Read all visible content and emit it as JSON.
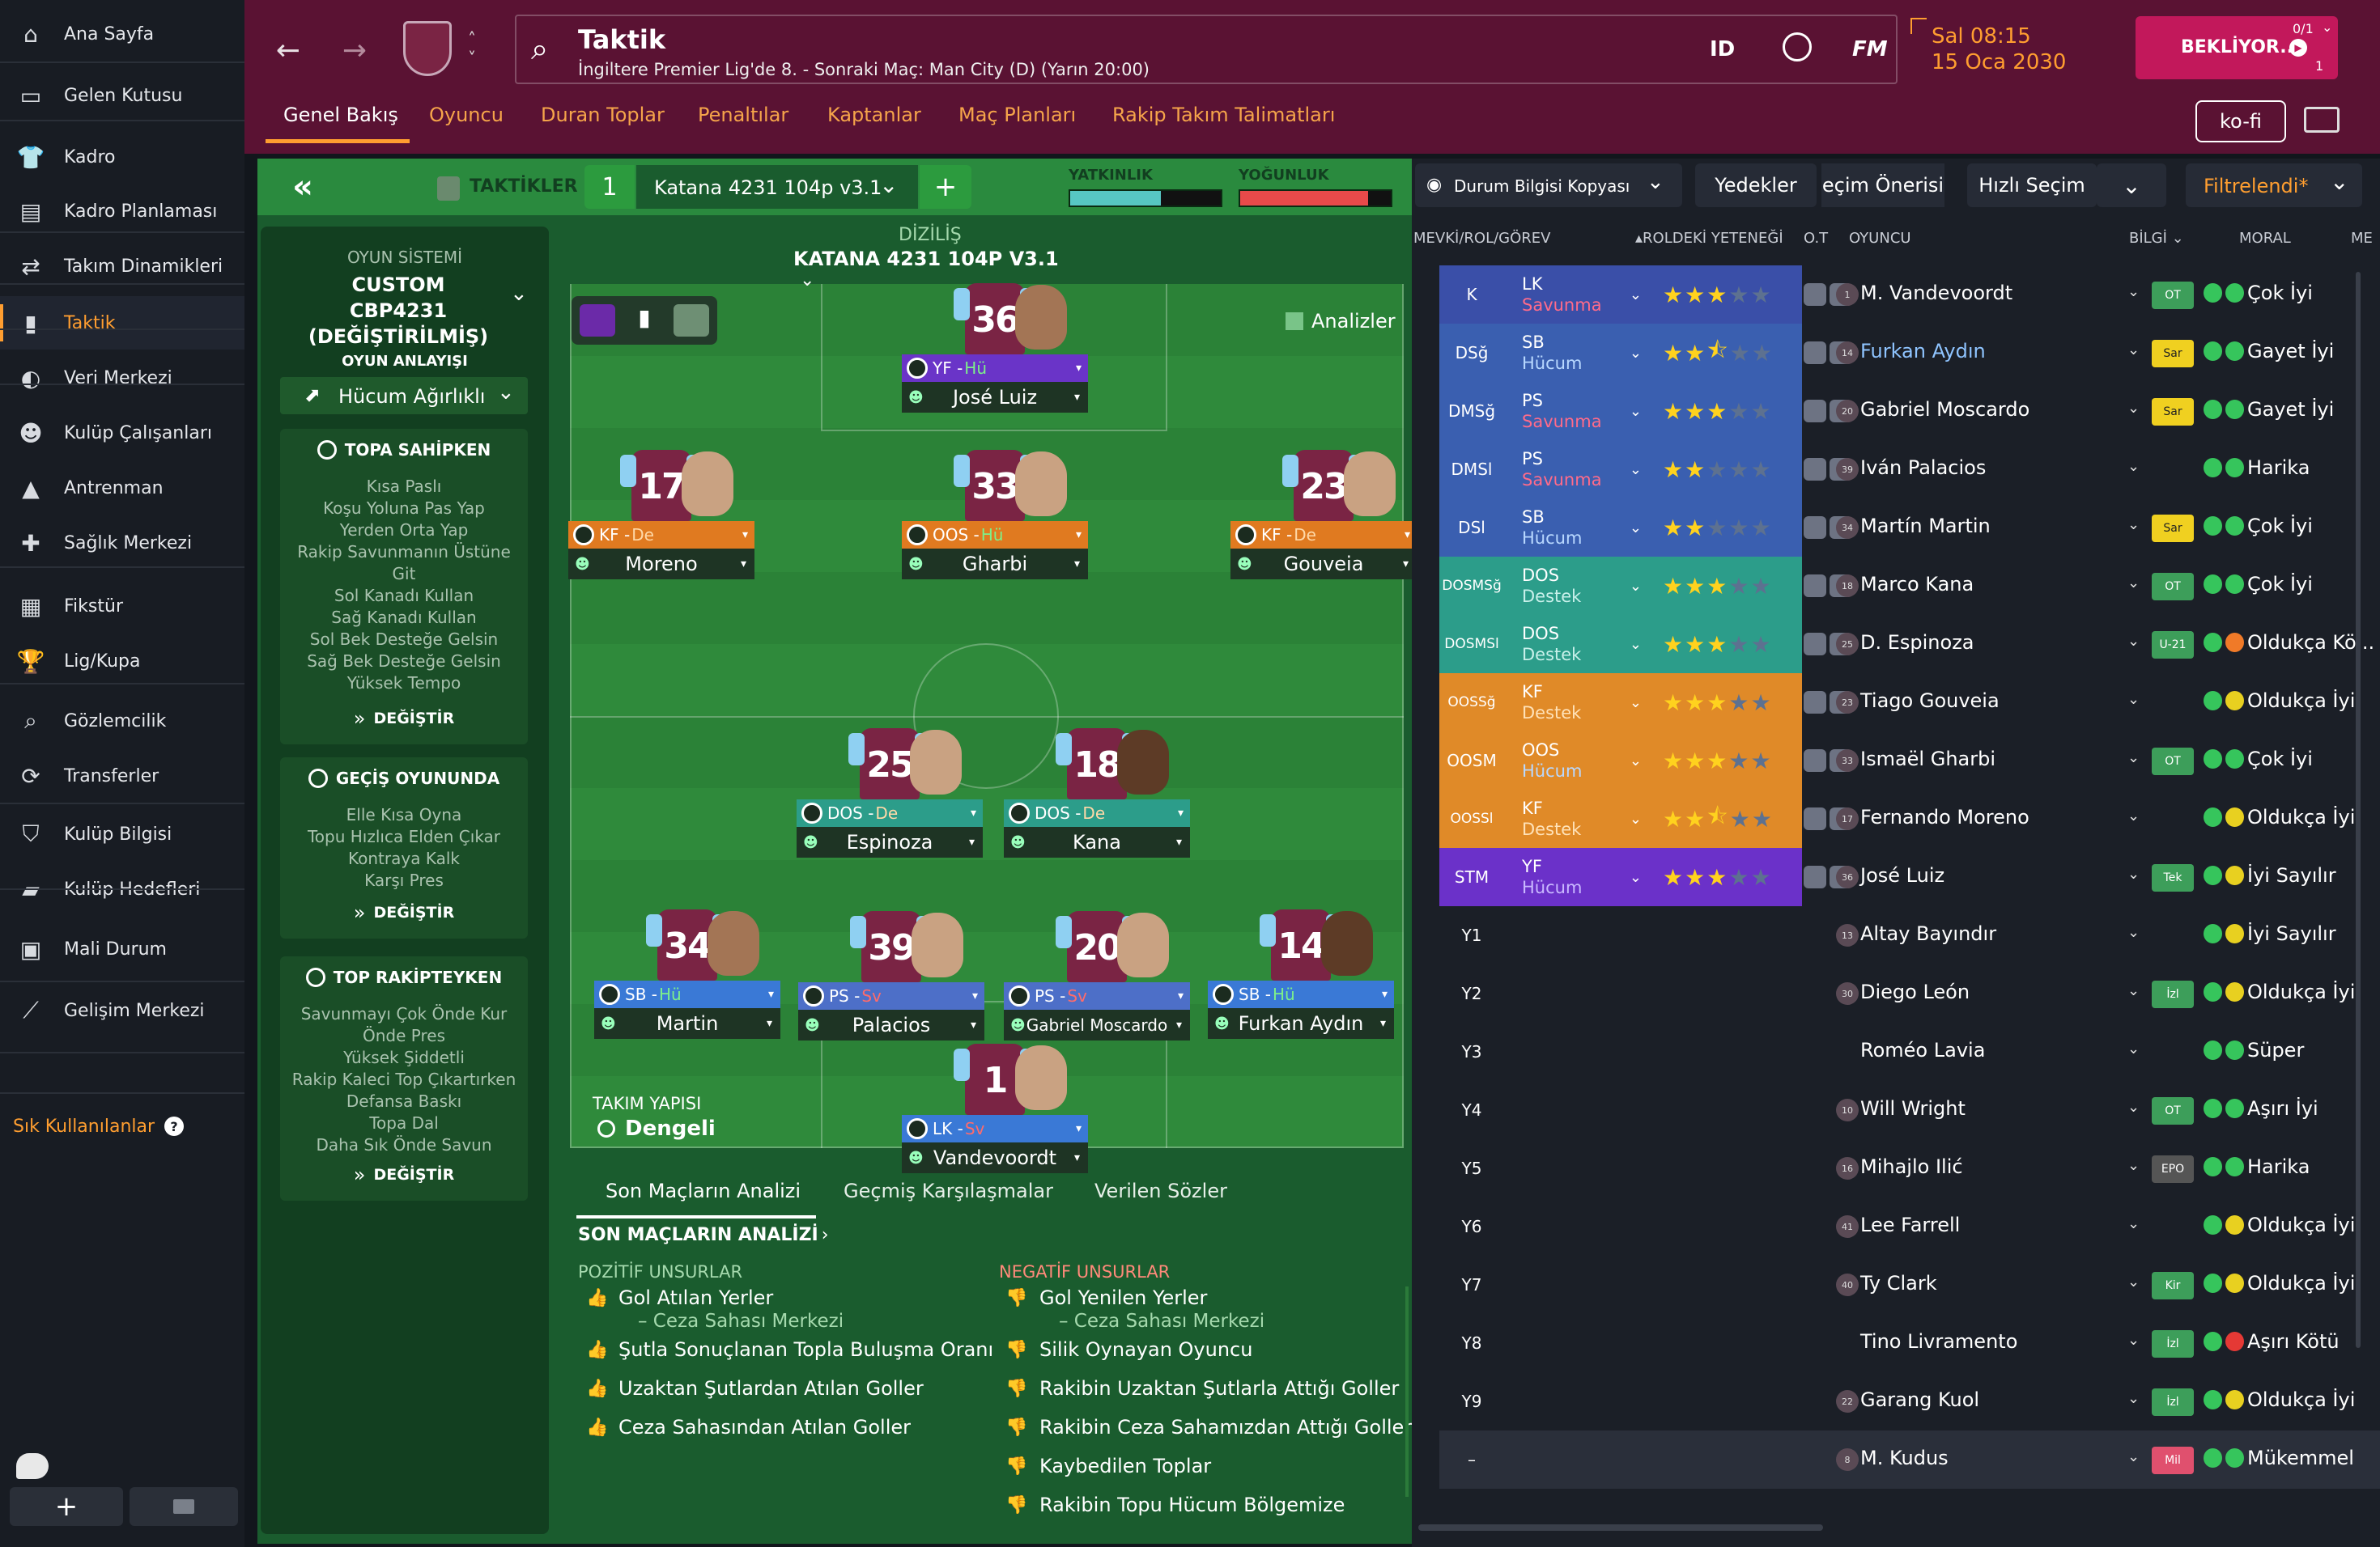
{
  "nav": {
    "items": [
      {
        "label": "Ana Sayfa",
        "icon": "home-icon",
        "glyph": "⌂"
      },
      {
        "label": "Gelen Kutusu",
        "icon": "inbox-icon",
        "glyph": "▭"
      },
      {
        "label": "Kadro",
        "icon": "shirt-icon",
        "glyph": "👕"
      },
      {
        "label": "Kadro Planlaması",
        "icon": "clipboard-icon",
        "glyph": "▤"
      },
      {
        "label": "Takım Dinamikleri",
        "icon": "dynamics-icon",
        "glyph": "⇄"
      },
      {
        "label": "Taktik",
        "icon": "tactics-icon",
        "glyph": "▮"
      },
      {
        "label": "Veri Merkezi",
        "icon": "data-icon",
        "glyph": "◐"
      },
      {
        "label": "Kulüp Çalışanları",
        "icon": "staff-icon",
        "glyph": "☻"
      },
      {
        "label": "Antrenman",
        "icon": "training-icon",
        "glyph": "▲"
      },
      {
        "label": "Sağlık Merkezi",
        "icon": "medical-icon",
        "glyph": "✚"
      },
      {
        "label": "Fikstür",
        "icon": "calendar-icon",
        "glyph": "▦"
      },
      {
        "label": "Lig/Kupa",
        "icon": "trophy-icon",
        "glyph": "🏆"
      },
      {
        "label": "Gözlemcilik",
        "icon": "scouting-icon",
        "glyph": "⌕"
      },
      {
        "label": "Transferler",
        "icon": "transfer-icon",
        "glyph": "⟳"
      },
      {
        "label": "Kulüp Bilgisi",
        "icon": "shield-icon",
        "glyph": "⛉"
      },
      {
        "label": "Kulüp Hedefleri",
        "icon": "briefcase-icon",
        "glyph": "▰"
      },
      {
        "label": "Mali Durum",
        "icon": "money-icon",
        "glyph": "▣"
      },
      {
        "label": "Gelişim Merkezi",
        "icon": "development-icon",
        "glyph": "⟋"
      }
    ],
    "favorites": "Sık Kullanılanlar",
    "help": "?"
  },
  "header": {
    "title": "Taktik",
    "subtitle": "İngiltere Premier Lig'de 8. - Sonraki Maç: Man City (D) (Yarın 20:00)",
    "id": "ID",
    "fm": "FM",
    "time": "Sal 08:15",
    "date": "15 Oca 2030",
    "waiting": "BEKLİYOR...",
    "count": "0/1",
    "users": "1",
    "kofi": "ko-fi",
    "tabs": [
      "Genel Bakış",
      "Oyuncu",
      "Duran Toplar",
      "Penaltılar",
      "Kaptanlar",
      "Maç Planları",
      "Rakip Takım Talimatları"
    ]
  },
  "tactics": {
    "collapse": "«",
    "label": "TAKTİKLER",
    "slot": "1",
    "name": "Katana 4231 104p v3.1",
    "add": "+",
    "familiarity": "YATKINLIK",
    "intensity": "YOĞUNLUK",
    "familiarity_level": 0.6,
    "intensity_level": 0.85,
    "formation_label": "DİZİLİŞ",
    "formation_name": "KATANA 4231 104P V3.1",
    "analyses": "Analizler",
    "structure_label": "TAKIM YAPISI",
    "structure_value": "Dengeli"
  },
  "sidepanel": {
    "system_label": "OYUN SİSTEMİ",
    "system_value": "CUSTOM CBP4231 (DEĞİŞTİRİLMİŞ)",
    "approach_label": "OYUN ANLAYIŞI",
    "approach_value": "Hücum Ağırlıklı",
    "change": "DEĞİŞTİR",
    "in_possession": {
      "title": "TOPA SAHİPKEN",
      "items": [
        "Kısa Paslı",
        "Koşu Yoluna Pas Yap",
        "Yerden Orta Yap",
        "Rakip Savunmanın Üstüne Git",
        "Sol Kanadı Kullan",
        "Sağ Kanadı Kullan",
        "Sol Bek Desteğe Gelsin",
        "Sağ Bek Desteğe Gelsin",
        "Yüksek Tempo"
      ]
    },
    "transition": {
      "title": "GEÇİŞ OYUNUNDA",
      "items": [
        "Elle Kısa Oyna",
        "Topu Hızlıca Elden Çıkar",
        "Kontraya Kalk",
        "Karşı Pres"
      ]
    },
    "out_possession": {
      "title": "TOP RAKİPTEYKEN",
      "items": [
        "Savunmayı Çok Önde Kur",
        "Önde Pres",
        "Yüksek Şiddetli",
        "Rakip Kaleci Top Çıkartırken",
        "Defansa Baskı",
        "Topa Dal",
        "Daha Sık Önde Savun"
      ]
    }
  },
  "pitch_players": [
    {
      "num": "36",
      "role": "YF - ",
      "duty": "Hü",
      "name": "José Luiz",
      "rolebg": "purple",
      "face": "mid"
    },
    {
      "num": "17",
      "role": "KF - ",
      "duty": "De",
      "name": "Moreno",
      "rolebg": "orange",
      "face": "light"
    },
    {
      "num": "33",
      "role": "OOS - ",
      "duty": "Hü",
      "name": "Gharbi",
      "rolebg": "orange",
      "face": "light"
    },
    {
      "num": "23",
      "role": "KF - ",
      "duty": "De",
      "name": "Gouveia",
      "rolebg": "orange",
      "face": "light"
    },
    {
      "num": "25",
      "role": "DOS - ",
      "duty": "De",
      "name": "Espinoza",
      "rolebg": "teal",
      "face": "light"
    },
    {
      "num": "18",
      "role": "DOS - ",
      "duty": "De",
      "name": "Kana",
      "rolebg": "teal",
      "face": "dark"
    },
    {
      "num": "34",
      "role": "SB - ",
      "duty": "Hü",
      "name": "Martin",
      "rolebg": "blue",
      "face": "mid"
    },
    {
      "num": "39",
      "role": "PS - ",
      "duty": "Sv",
      "name": "Palacios",
      "rolebg": "slate",
      "face": "light"
    },
    {
      "num": "20",
      "role": "PS - ",
      "duty": "Sv",
      "name": "Gabriel Moscardo",
      "rolebg": "slate",
      "face": "light"
    },
    {
      "num": "14",
      "role": "SB - ",
      "duty": "Hü",
      "name": "Furkan Aydın",
      "rolebg": "blue",
      "face": "dark"
    },
    {
      "num": "1",
      "role": "LK - ",
      "duty": "Sv",
      "name": "Vandevoordt",
      "rolebg": "blue",
      "face": "light"
    }
  ],
  "bottom": {
    "tabs": [
      "Son Maçların Analizi",
      "Geçmiş Karşılaşmalar",
      "Verilen Sözler"
    ],
    "section": "SON MAÇLARIN ANALİZİ",
    "positive_title": "POZİTİF UNSURLAR",
    "negative_title": "NEGATİF UNSURLAR",
    "positive": [
      {
        "text": "Gol Atılan Yerler",
        "sub": "– Ceza Sahası Merkezi"
      },
      {
        "text": "Şutla Sonuçlanan Topla Buluşma Oranı",
        "sub": ""
      },
      {
        "text": "Uzaktan Şutlardan Atılan Goller",
        "sub": ""
      },
      {
        "text": "Ceza Sahasından Atılan Goller",
        "sub": ""
      }
    ],
    "negative": [
      {
        "text": "Gol Yenilen Yerler",
        "sub": "– Ceza Sahası Merkezi"
      },
      {
        "text": "Silik Oynayan Oyuncu",
        "sub": ""
      },
      {
        "text": "Rakibin Uzaktan Şutlarla Attığı Goller",
        "sub": ""
      },
      {
        "text": "Rakibin Ceza Sahamızdan Attığı Goller",
        "sub": ""
      },
      {
        "text": "Kaybedilen Toplar",
        "sub": ""
      },
      {
        "text": "Rakibin Topu Hücum Bölgemize",
        "sub": ""
      }
    ]
  },
  "list": {
    "toolbar": {
      "copy": "Durum Bilgisi Kopyası",
      "subs": "Yedekler",
      "suggest": "eçim Önerisi",
      "quick": "Hızlı Seçim",
      "filtered": "Filtrelendi*"
    },
    "headers": {
      "pos": "MEVKİ/ROL/GÖREV",
      "ability": "ROLDEKİ YETENEĞİ",
      "ot": "O.T",
      "player": "OYUNCU",
      "info": "BİLGİ",
      "morale": "MORAL",
      "me": "ME"
    },
    "rows": [
      {
        "pos": "K",
        "role": "LK",
        "duty": "Savunma",
        "stars": 3,
        "half": false,
        "num": "1",
        "name": "M. Vandevoordt",
        "badge": "OT",
        "morale": "Çok İyi",
        "mcolor": "green",
        "blue": false
      },
      {
        "pos": "DSğ",
        "role": "SB",
        "duty": "Hücum",
        "stars": 2,
        "half": true,
        "num": "14",
        "name": "Furkan Aydın",
        "badge": "Sar",
        "morale": "Gayet İyi",
        "mcolor": "green",
        "blue": true
      },
      {
        "pos": "DMSğ",
        "role": "PS",
        "duty": "Savunma",
        "stars": 3,
        "half": false,
        "num": "20",
        "name": "Gabriel Moscardo",
        "badge": "Sar",
        "morale": "Gayet İyi",
        "mcolor": "green",
        "blue": false
      },
      {
        "pos": "DMSl",
        "role": "PS",
        "duty": "Savunma",
        "stars": 2,
        "half": false,
        "num": "39",
        "name": "Iván Palacios",
        "badge": "",
        "morale": "Harika",
        "mcolor": "green",
        "blue": false
      },
      {
        "pos": "DSl",
        "role": "SB",
        "duty": "Hücum",
        "stars": 2,
        "half": false,
        "num": "34",
        "name": "Martín Martin",
        "badge": "Sar",
        "morale": "Çok İyi",
        "mcolor": "green",
        "blue": false
      },
      {
        "pos": "DOSMSğ",
        "role": "DOS",
        "duty": "Destek",
        "stars": 3,
        "half": false,
        "num": "18",
        "name": "Marco Kana",
        "badge": "OT",
        "morale": "Çok İyi",
        "mcolor": "green",
        "blue": false
      },
      {
        "pos": "DOSMSl",
        "role": "DOS",
        "duty": "Destek",
        "stars": 3,
        "half": false,
        "num": "25",
        "name": "D. Espinoza",
        "badge": "U-21",
        "morale": "Oldukça Kö...",
        "mcolor": "orange",
        "blue": false
      },
      {
        "pos": "OOSSğ",
        "role": "KF",
        "duty": "Destek",
        "stars": 3,
        "half": false,
        "num": "23",
        "name": "Tiago Gouveia",
        "badge": "",
        "morale": "Oldukça İyi",
        "mcolor": "yellow",
        "blue": false
      },
      {
        "pos": "OOSM",
        "role": "OOS",
        "duty": "Hücum",
        "stars": 3,
        "half": false,
        "num": "33",
        "name": "Ismaël Gharbi",
        "badge": "OT",
        "morale": "Çok İyi",
        "mcolor": "green",
        "blue": false
      },
      {
        "pos": "OOSSl",
        "role": "KF",
        "duty": "Destek",
        "stars": 2,
        "half": true,
        "num": "17",
        "name": "Fernando Moreno",
        "badge": "",
        "morale": "Oldukça İyi",
        "mcolor": "yellow",
        "blue": false
      },
      {
        "pos": "STM",
        "role": "YF",
        "duty": "Hücum",
        "stars": 3,
        "half": false,
        "num": "36",
        "name": "José Luiz",
        "badge": "Tek",
        "morale": "İyi Sayılır",
        "mcolor": "yellow",
        "blue": false
      },
      {
        "pos": "Y1",
        "role": "",
        "duty": "",
        "stars": 0,
        "half": false,
        "num": "13",
        "name": "Altay Bayındır",
        "badge": "",
        "morale": "İyi Sayılır",
        "mcolor": "yellow",
        "blue": false
      },
      {
        "pos": "Y2",
        "role": "",
        "duty": "",
        "stars": 0,
        "half": false,
        "num": "30",
        "name": "Diego León",
        "badge": "İzl",
        "morale": "Oldukça İyi",
        "mcolor": "yellow",
        "blue": false
      },
      {
        "pos": "Y3",
        "role": "",
        "duty": "",
        "stars": 0,
        "half": false,
        "num": "",
        "name": "Roméo Lavia",
        "badge": "",
        "morale": "Süper",
        "mcolor": "green",
        "blue": false
      },
      {
        "pos": "Y4",
        "role": "",
        "duty": "",
        "stars": 0,
        "half": false,
        "num": "10",
        "name": "Will Wright",
        "badge": "OT",
        "morale": "Aşırı İyi",
        "mcolor": "green",
        "blue": false
      },
      {
        "pos": "Y5",
        "role": "",
        "duty": "",
        "stars": 0,
        "half": false,
        "num": "16",
        "name": "Mihajlo Ilić",
        "badge": "EPO",
        "morale": "Harika",
        "mcolor": "green",
        "blue": false
      },
      {
        "pos": "Y6",
        "role": "",
        "duty": "",
        "stars": 0,
        "half": false,
        "num": "41",
        "name": "Lee Farrell",
        "badge": "",
        "morale": "Oldukça İyi",
        "mcolor": "yellow",
        "blue": false
      },
      {
        "pos": "Y7",
        "role": "",
        "duty": "",
        "stars": 0,
        "half": false,
        "num": "40",
        "name": "Ty Clark",
        "badge": "Kir",
        "morale": "Oldukça İyi",
        "mcolor": "yellow",
        "blue": false
      },
      {
        "pos": "Y8",
        "role": "",
        "duty": "",
        "stars": 0,
        "half": false,
        "num": "",
        "name": "Tino Livramento",
        "badge": "İzl",
        "morale": "Aşırı Kötü",
        "mcolor": "red",
        "blue": false
      },
      {
        "pos": "Y9",
        "role": "",
        "duty": "",
        "stars": 0,
        "half": false,
        "num": "22",
        "name": "Garang Kuol",
        "badge": "İzl",
        "morale": "Oldukça İyi",
        "mcolor": "yellow",
        "blue": false
      },
      {
        "pos": "–",
        "role": "",
        "duty": "",
        "stars": 0,
        "half": false,
        "num": "8",
        "name": "M. Kudus",
        "badge": "Mil",
        "morale": "Mükemmel",
        "mcolor": "green",
        "blue": false
      }
    ]
  },
  "colors": {
    "accent": "#ff9e30",
    "header": "#5a1233",
    "pitch": "#2f8a3b",
    "gk": "#3a4fa8",
    "def": "#3a5fb0",
    "dm": "#2c9d8a",
    "am": "#e08a28",
    "st": "#6b31c9"
  }
}
